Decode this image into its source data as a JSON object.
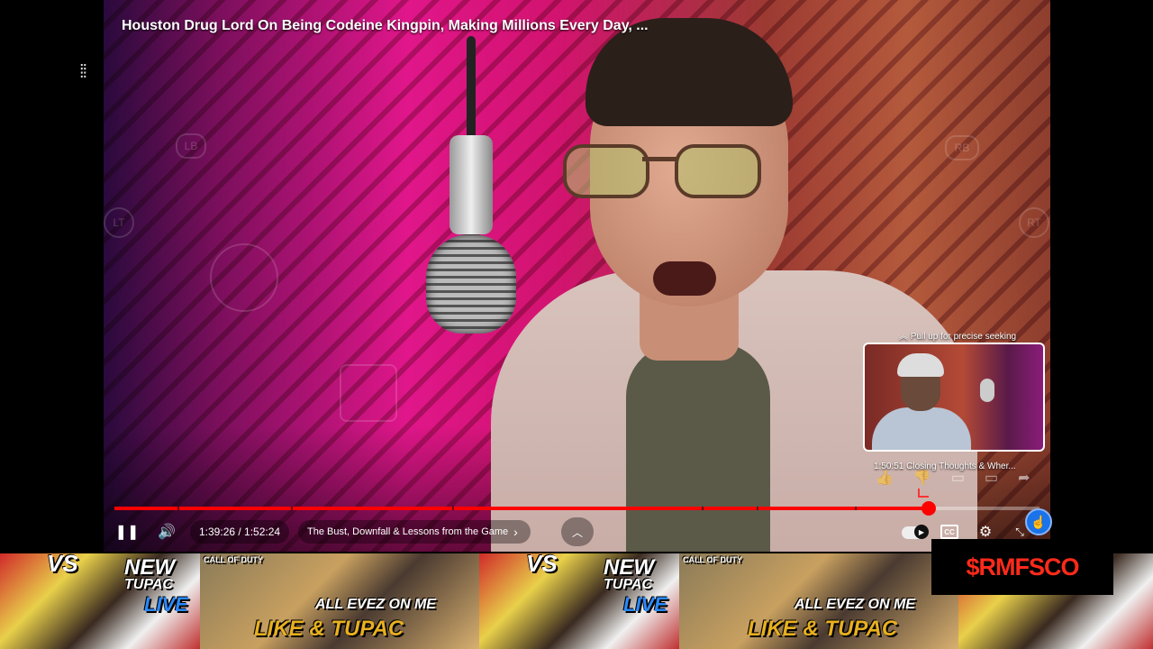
{
  "video": {
    "title": "Houston Drug Lord On Being Codeine Kingpin, Making Millions Every Day, ...",
    "progress_fraction": 0.88
  },
  "seek_preview": {
    "hint": "Pull up for precise seeking",
    "timestamp": "1:50:51",
    "chapter": "Closing Thoughts & Wher..."
  },
  "controls": {
    "play_state_icon": "pause-icon",
    "volume_icon": "volume-icon",
    "time_display": "1:39:26 / 1:52:24",
    "chapter_label": "The Bust, Downfall & Lessons from the Game",
    "chapter_chevron": "›",
    "expand_icon": "chevron-up-icon",
    "autoplay_icon": "autoplay-toggle-icon",
    "cc_label": "CC",
    "settings_icon": "gear-icon",
    "fullscreen_exit_icon": "exit-fullscreen-icon"
  },
  "overlay_controls": {
    "ghost_labels": [
      "LB",
      "LT",
      "RT",
      "RB"
    ]
  },
  "ticker": {
    "tiles": [
      {
        "kind": "a",
        "big": "NEW",
        "sub": "TUPAC",
        "tag": "LIVE",
        "vs": "VS",
        "corner": "CALL OF DUTY"
      },
      {
        "kind": "b",
        "big": "ALL EVEZ ON ME",
        "sub": "LIKE & TUPAC"
      },
      {
        "kind": "a",
        "big": "NEW",
        "sub": "TUPAC",
        "tag": "LIVE",
        "vs": "VS",
        "corner": "CALL OF DUTY"
      },
      {
        "kind": "b",
        "big": "ALL EVEZ ON ME",
        "sub": "LIKE & TUPAC"
      }
    ]
  },
  "brand_watermark": "$RMFSCO",
  "colors": {
    "progress": "#ff0000",
    "brand": "#ff2a1a",
    "touch_cursor": "#1a73e8"
  }
}
